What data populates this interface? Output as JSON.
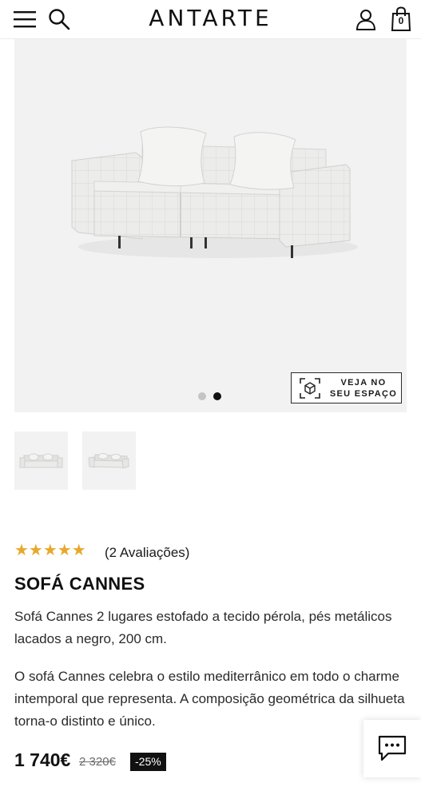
{
  "header": {
    "logo": "ANTARTE",
    "cart_count": "0",
    "icons": {
      "menu": "hamburger-menu-icon",
      "search": "search-icon",
      "user": "user-icon",
      "bag": "shopping-bag-icon"
    }
  },
  "gallery": {
    "ar_button_label_line1": "VEJA NO",
    "ar_button_label_line2": "SEU ESPAÇO",
    "ar_icon": "ar-view-icon",
    "dots_count": 2,
    "active_dot": 2
  },
  "thumbnails": [
    {
      "name": "thumbnail-1"
    },
    {
      "name": "thumbnail-2"
    }
  ],
  "product": {
    "rating": 5,
    "stars": "★★★★★",
    "reviews": "(2 Avaliações)",
    "title": "SOFÁ CANNES",
    "short_description": "Sofá Cannes 2 lugares estofado a tecido pérola, pés metálicos lacados a negro, 200 cm.",
    "long_description": "O sofá Cannes celebra o estilo mediterrânico em todo o charme intemporal que representa. A composição geométrica da silhueta torna-o distinto e único.",
    "price": "1 740€",
    "old_price": "2 320€",
    "discount": "-25%"
  },
  "colors": {
    "star": "#e7a92b",
    "text": "#1a1a1a",
    "discount_bg": "#111111",
    "gallery_bg": "#f2f2f2"
  },
  "chat": {
    "icon": "chat-bubble-icon"
  }
}
